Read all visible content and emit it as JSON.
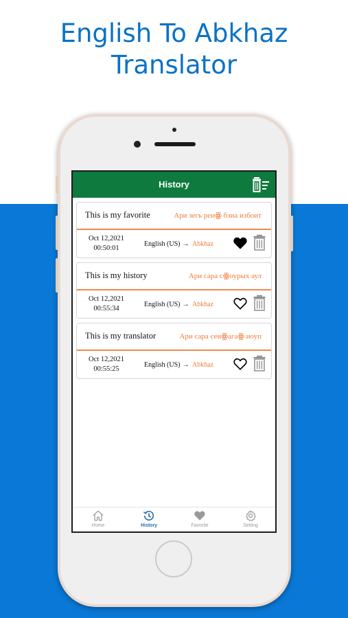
{
  "promo": {
    "title_line1": "English To Abkhaz",
    "title_line2": "Translator"
  },
  "colors": {
    "header_green": "#0f7a3d",
    "accent_orange": "#ef7d3a",
    "background_blue": "#0a78d6",
    "title_blue": "#0b72c4"
  },
  "header": {
    "title": "History",
    "clear_icon": "clear-history-icon"
  },
  "history": [
    {
      "source_text": "This is my favorite",
      "translated_text": "Ари зегь реиꙮ бзиа избоит",
      "date": "Oct 12,2021",
      "time": "00:50:01",
      "from_lang": "English (US)",
      "arrow": "→",
      "to_lang": "Abkhaz",
      "favorited": true
    },
    {
      "source_text": "This is my history",
      "translated_text": "Ари сара сꙮоурых аул",
      "date": "Oct 12,2021",
      "time": "00:55:34",
      "from_lang": "English (US)",
      "arrow": "→",
      "to_lang": "Abkhaz",
      "favorited": false
    },
    {
      "source_text": "This is my translator",
      "translated_text": "Ари сара сеиꙮагаꙮ иоуп",
      "date": "Oct 12,2021",
      "time": "00:55:25",
      "from_lang": "English (US)",
      "arrow": "→",
      "to_lang": "Abkhaz",
      "favorited": false
    }
  ],
  "nav": {
    "active": "History",
    "items": [
      {
        "label": "Home",
        "icon": "home-icon"
      },
      {
        "label": "History",
        "icon": "history-icon"
      },
      {
        "label": "Favorite",
        "icon": "heart-icon"
      },
      {
        "label": "Setting",
        "icon": "gear-icon"
      }
    ]
  }
}
